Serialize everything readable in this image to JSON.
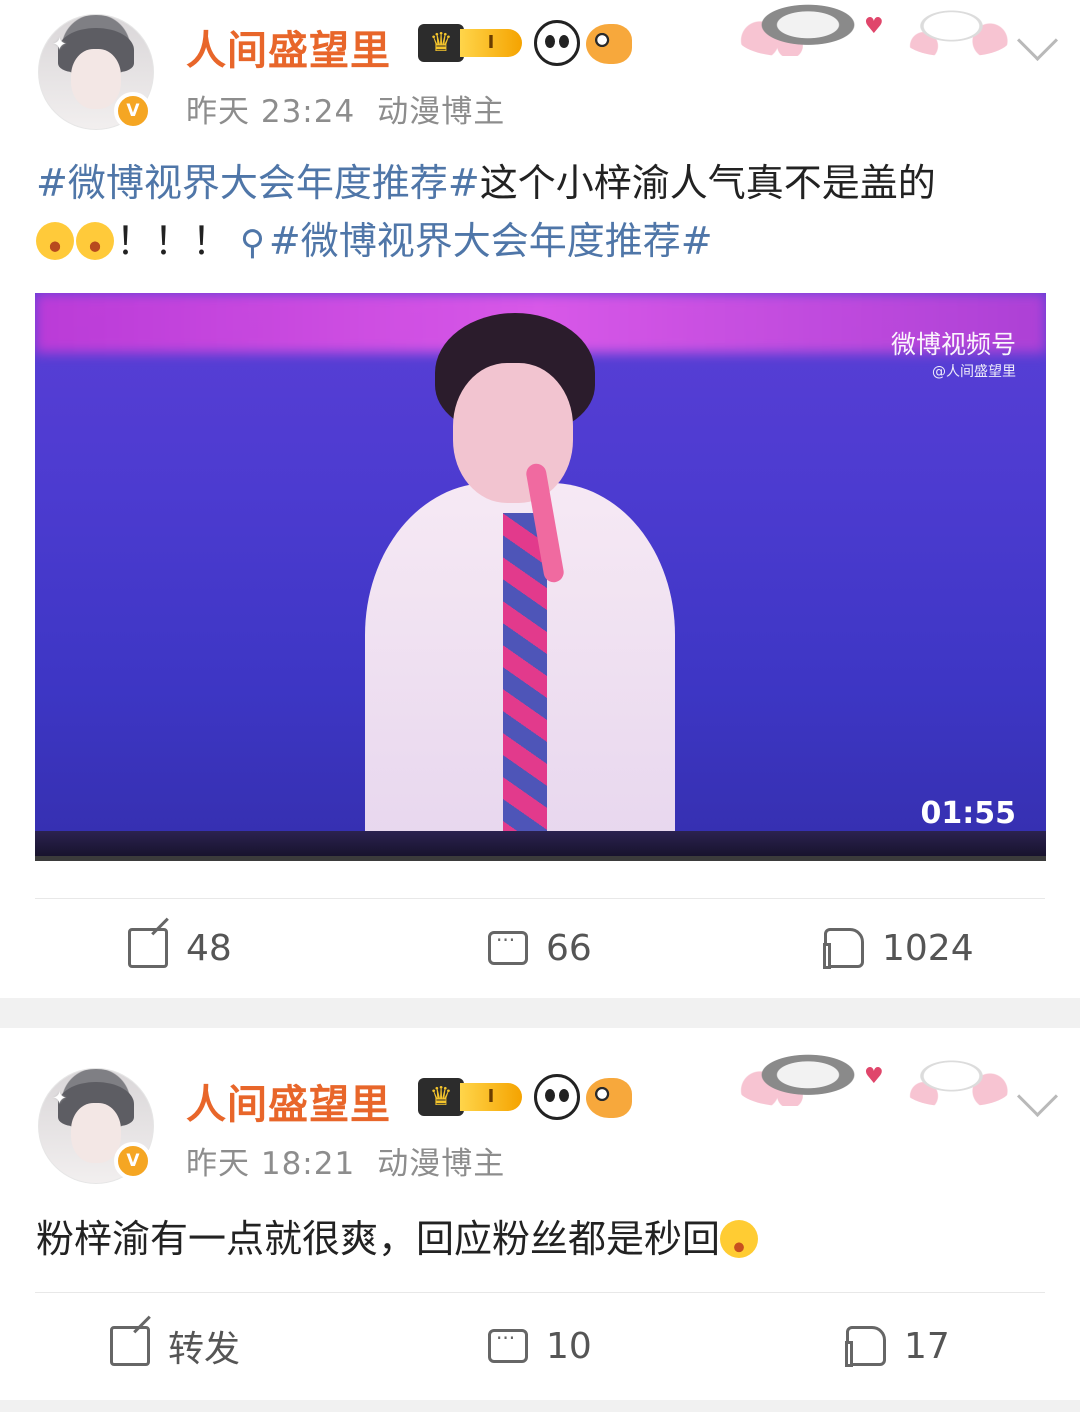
{
  "posts": [
    {
      "author": "人间盛望里",
      "level": "I",
      "time": "昨天 23:24",
      "source": "动漫博主",
      "text": {
        "topic1": "#微博视界大会年度推荐#",
        "body": "这个小梓渝人气真不是盖的",
        "exclaim": "！！！",
        "topic2": "#微博视界大会年度推荐#"
      },
      "video": {
        "brand": "微博视频号",
        "brand_sub": "@人间盛望里",
        "duration": "01:55"
      },
      "actions": {
        "share": "48",
        "comment": "66",
        "like": "1024"
      }
    },
    {
      "author": "人间盛望里",
      "level": "I",
      "time": "昨天 18:21",
      "source": "动漫博主",
      "text": {
        "body": "粉梓渝有一点就很爽，回应粉丝都是秒回"
      },
      "actions": {
        "share": "转发",
        "comment": "10",
        "like": "17"
      }
    }
  ],
  "colors": {
    "name": "#e8662a",
    "topic": "#4f76a8",
    "meta": "#8d8d8d",
    "verified": "#f5a623"
  },
  "icons": {
    "verified": "verified-v-icon",
    "crown": "crown-icon",
    "panda": "panda-icon",
    "fish": "pufferfish-icon",
    "chevron": "chevron-down-icon",
    "search": "search-icon",
    "share": "share-icon",
    "comment": "comment-icon",
    "like": "thumbs-up-icon"
  }
}
